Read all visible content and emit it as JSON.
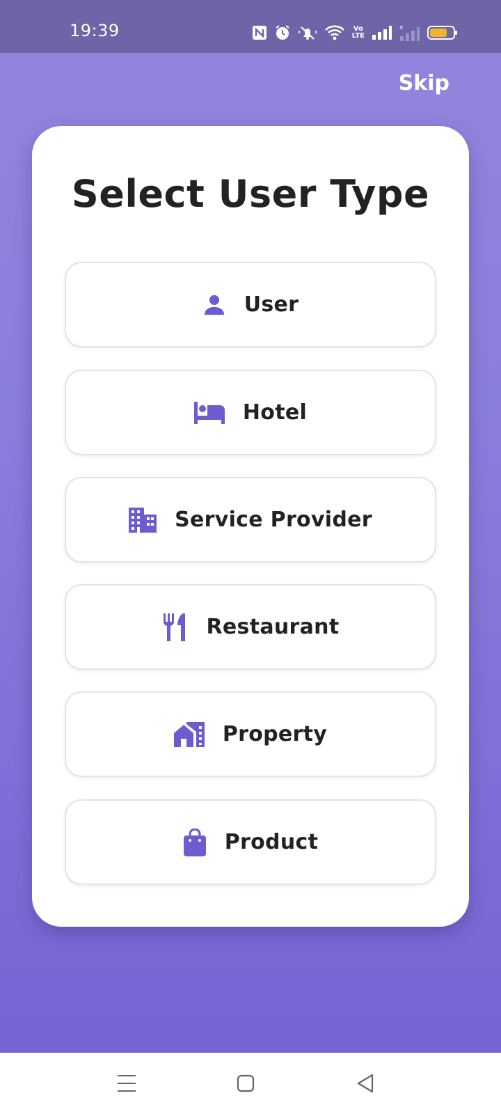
{
  "status_bar": {
    "time": "19:39",
    "icons": [
      "nfc-icon",
      "alarm-icon",
      "mute-icon",
      "wifi-icon",
      "volte-icon",
      "signal-icon",
      "signal-no-service-icon",
      "battery-icon"
    ],
    "volte_top": "Vo",
    "volte_bottom": "LTE"
  },
  "header": {
    "skip_label": "Skip"
  },
  "card": {
    "title": "Select User Type",
    "options": [
      {
        "label": "User",
        "icon": "person-icon"
      },
      {
        "label": "Hotel",
        "icon": "bed-icon"
      },
      {
        "label": "Service Provider",
        "icon": "building-icon"
      },
      {
        "label": "Restaurant",
        "icon": "restaurant-icon"
      },
      {
        "label": "Property",
        "icon": "house-icon"
      },
      {
        "label": "Product",
        "icon": "shopping-bag-icon"
      }
    ]
  },
  "nav_bar": {
    "buttons": [
      "menu-icon",
      "home-icon",
      "back-icon"
    ]
  },
  "colors": {
    "accent": "#6c5ccf",
    "gradient_top": "#9386de",
    "gradient_bottom": "#7764d5",
    "status_bar": "#6e64a8",
    "battery": "#f0b429"
  }
}
